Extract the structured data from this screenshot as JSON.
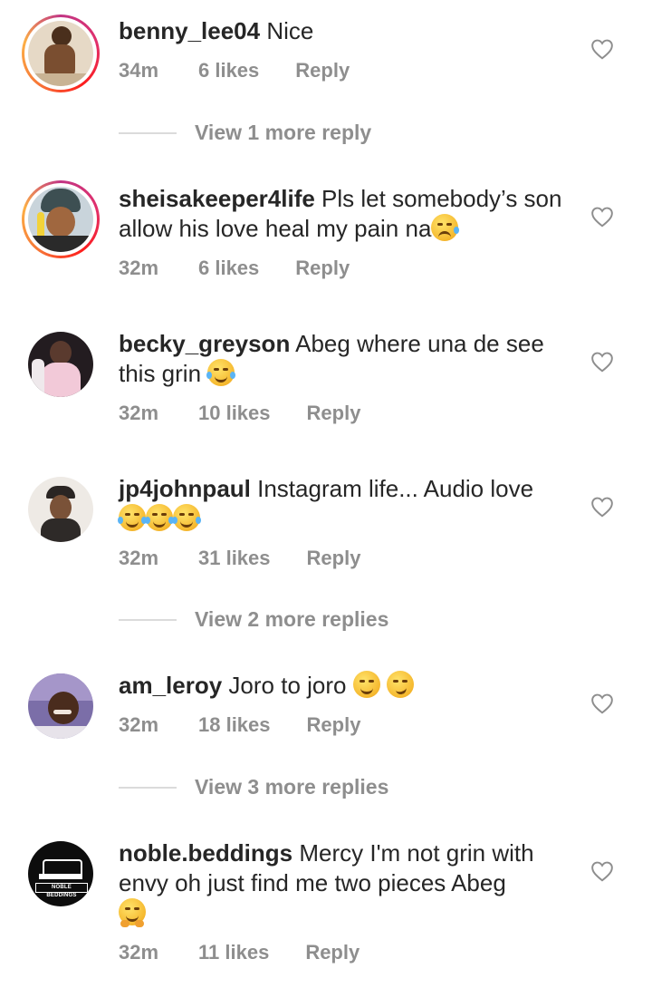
{
  "comments": [
    {
      "username": "benny_lee04",
      "text": "Nice",
      "time": "34m",
      "likes": "6 likes",
      "reply": "Reply",
      "view_more": "View 1 more reply",
      "avatar_colors": [
        "#d7c4a8",
        "#6b4a2d"
      ]
    },
    {
      "username": "sheisakeeper4life",
      "text": "Pls let somebody’s son allow his love heal my pain na",
      "emoji": "crying-face-emoji",
      "time": "32m",
      "likes": "6 likes",
      "reply": "Reply",
      "avatar_colors": [
        "#c8d3da",
        "#3b2a20"
      ]
    },
    {
      "username": "becky_greyson",
      "text": "Abeg where una de see this grin",
      "emoji": "tears-of-joy-emoji",
      "time": "32m",
      "likes": "10 likes",
      "reply": "Reply",
      "avatar_colors": [
        "#2a2024",
        "#f0c8d6"
      ]
    },
    {
      "username": "jp4johnpaul",
      "text": "Instagram life... Audio love",
      "emoji": "tears-of-joy-emoji x3",
      "time": "32m",
      "likes": "31 likes",
      "reply": "Reply",
      "view_more": "View 2 more replies",
      "avatar_colors": [
        "#ece6df",
        "#2b2623"
      ]
    },
    {
      "username": "am_leroy",
      "text": "Joro to joro",
      "emoji": "relieved-face-emoji, smirking-face-emoji",
      "time": "32m",
      "likes": "18 likes",
      "reply": "Reply",
      "view_more": "View 3 more replies",
      "avatar_colors": [
        "#7a6aa5",
        "#3b2418"
      ]
    },
    {
      "username": "noble.beddings",
      "text": "Mercy I'm not grin with envy oh just find me two pieces Abeg",
      "emoji": "hugging-face-emoji",
      "time": "32m",
      "likes": "11 likes",
      "reply": "Reply",
      "avatar_colors": [
        "#0d0d0d",
        "#ffffff"
      ],
      "avatar_logo_text": "NOBLE BEDDINGS"
    }
  ],
  "colors": {
    "text": "#262626",
    "muted": "#8e8e8e",
    "divider": "#dbdbdb",
    "story_ring": "#e1306c"
  },
  "icons": {
    "like": "heart-outline-icon"
  }
}
